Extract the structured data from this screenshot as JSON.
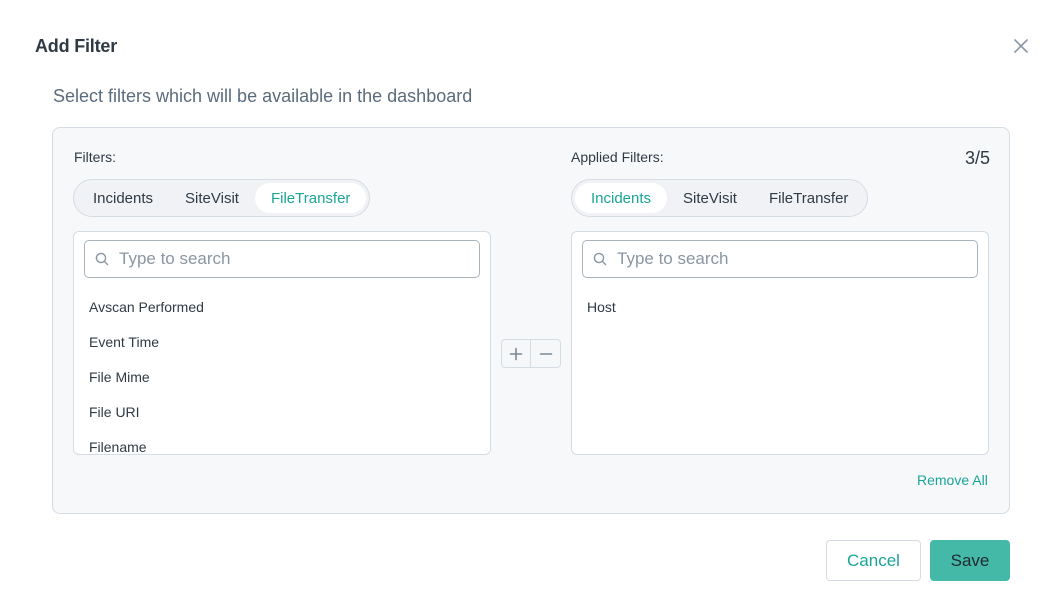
{
  "dialog": {
    "title": "Add Filter",
    "subtitle": "Select filters which will be available in the dashboard"
  },
  "filters": {
    "label": "Filters:",
    "tabs": [
      "Incidents",
      "SiteVisit",
      "FileTransfer"
    ],
    "active_tab": "FileTransfer",
    "search_placeholder": "Type to search",
    "items": [
      "Avscan Performed",
      "Event Time",
      "File Mime",
      "File URI",
      "Filename"
    ]
  },
  "applied": {
    "label": "Applied Filters:",
    "count": "3/5",
    "tabs": [
      "Incidents",
      "SiteVisit",
      "FileTransfer"
    ],
    "active_tab": "Incidents",
    "search_placeholder": "Type to search",
    "items": [
      "Host"
    ],
    "remove_all_label": "Remove All"
  },
  "footer": {
    "cancel_label": "Cancel",
    "save_label": "Save"
  },
  "colors": {
    "accent": "#1aa597",
    "save_bg": "#45b9a7",
    "panel_bg": "#f7f8fa"
  }
}
